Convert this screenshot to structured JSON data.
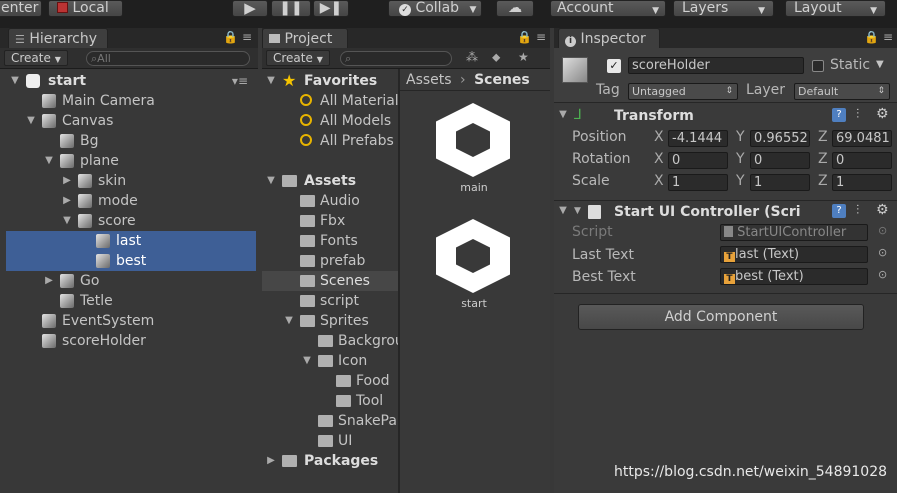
{
  "toolbar": {
    "center_label": "enter",
    "local_label": "Local",
    "collab_label": "Collab",
    "account_label": "Account",
    "layers_label": "Layers",
    "layout_label": "Layout"
  },
  "hierarchy": {
    "tab_label": "Hierarchy",
    "create_label": "Create",
    "search_placeholder": "All",
    "scene_name": "start",
    "items": [
      {
        "label": "Main Camera",
        "depth": 1,
        "arrow": ""
      },
      {
        "label": "Canvas",
        "depth": 1,
        "arrow": "down"
      },
      {
        "label": "Bg",
        "depth": 2,
        "arrow": ""
      },
      {
        "label": "plane",
        "depth": 2,
        "arrow": "down"
      },
      {
        "label": "skin",
        "depth": 3,
        "arrow": "right"
      },
      {
        "label": "mode",
        "depth": 3,
        "arrow": "right"
      },
      {
        "label": "score",
        "depth": 3,
        "arrow": "down"
      },
      {
        "label": "last",
        "depth": 4,
        "arrow": "",
        "selected": true
      },
      {
        "label": "best",
        "depth": 4,
        "arrow": "",
        "selected": true
      },
      {
        "label": "Go",
        "depth": 2,
        "arrow": "right"
      },
      {
        "label": "Tetle",
        "depth": 2,
        "arrow": ""
      },
      {
        "label": "EventSystem",
        "depth": 1,
        "arrow": ""
      },
      {
        "label": "scoreHolder",
        "depth": 1,
        "arrow": ""
      }
    ]
  },
  "project": {
    "tab_label": "Project",
    "create_label": "Create",
    "favorites_label": "Favorites",
    "favorites": [
      "All Materials",
      "All Models",
      "All Prefabs"
    ],
    "assets_label": "Assets",
    "folders": [
      {
        "label": "Audio",
        "depth": 1,
        "arrow": ""
      },
      {
        "label": "Fbx",
        "depth": 1,
        "arrow": ""
      },
      {
        "label": "Fonts",
        "depth": 1,
        "arrow": ""
      },
      {
        "label": "prefab",
        "depth": 1,
        "arrow": ""
      },
      {
        "label": "Scenes",
        "depth": 1,
        "arrow": "",
        "selected": true
      },
      {
        "label": "script",
        "depth": 1,
        "arrow": ""
      },
      {
        "label": "Sprites",
        "depth": 1,
        "arrow": "down"
      },
      {
        "label": "Backgrou",
        "depth": 2,
        "arrow": ""
      },
      {
        "label": "Icon",
        "depth": 2,
        "arrow": "down"
      },
      {
        "label": "Food",
        "depth": 3,
        "arrow": ""
      },
      {
        "label": "Tool",
        "depth": 3,
        "arrow": ""
      },
      {
        "label": "SnakePa",
        "depth": 2,
        "arrow": ""
      },
      {
        "label": "UI",
        "depth": 2,
        "arrow": ""
      }
    ],
    "packages_label": "Packages",
    "breadcrumb_root": "Assets",
    "breadcrumb_current": "Scenes",
    "scene_assets": [
      "main",
      "start"
    ]
  },
  "inspector": {
    "tab_label": "Inspector",
    "object_name": "scoreHolder",
    "static_label": "Static",
    "tag_label": "Tag",
    "tag_value": "Untagged",
    "layer_label": "Layer",
    "layer_value": "Default",
    "transform": {
      "title": "Transform",
      "position_label": "Position",
      "rotation_label": "Rotation",
      "scale_label": "Scale",
      "axis_x": "X",
      "axis_y": "Y",
      "axis_z": "Z",
      "position": [
        "-4.1444",
        "0.96552",
        "69.0481"
      ],
      "rotation": [
        "0",
        "0",
        "0"
      ],
      "scale": [
        "1",
        "1",
        "1"
      ]
    },
    "component": {
      "title": "Start UI Controller (Scri",
      "script_label": "Script",
      "script_value": "StartUIController",
      "last_label": "Last Text",
      "last_value": "last (Text)",
      "best_label": "Best Text",
      "best_value": "best (Text)"
    },
    "add_component_label": "Add Component"
  },
  "watermark": "https://blog.csdn.net/weixin_54891028"
}
